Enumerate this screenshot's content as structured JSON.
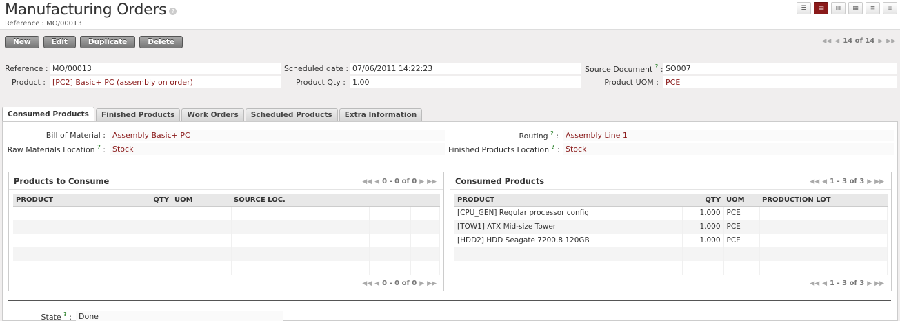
{
  "header": {
    "title": "Manufacturing Orders",
    "help": "?",
    "subtitle": "Reference : MO/00013"
  },
  "view_buttons": [
    "list-view-icon",
    "form-view-icon",
    "graph-view-icon",
    "calendar-view-icon",
    "gantt-view-icon",
    "diagram-view-icon"
  ],
  "toolbar": {
    "new_label": "New",
    "edit_label": "Edit",
    "duplicate_label": "Duplicate",
    "delete_label": "Delete",
    "pager": "14 of 14"
  },
  "form": {
    "reference_label": "Reference :",
    "reference_value": "MO/00013",
    "scheduled_label": "Scheduled date :",
    "scheduled_value": "07/06/2011 14:22:23",
    "source_label": "Source Document",
    "source_value": "SO007",
    "product_label": "Product :",
    "product_value": "[PC2] Basic+ PC (assembly on order)",
    "qty_label": "Product Qty :",
    "qty_value": "1.00",
    "uom_label": "Product UOM :",
    "uom_value": "PCE",
    "help_mark": "?"
  },
  "tabs": [
    {
      "label": "Consumed Products"
    },
    {
      "label": "Finished Products"
    },
    {
      "label": "Work Orders"
    },
    {
      "label": "Scheduled Products"
    },
    {
      "label": "Extra Information"
    }
  ],
  "tab_content": {
    "bom_label": "Bill of Material :",
    "bom_value": "Assembly Basic+ PC",
    "routing_label": "Routing",
    "routing_value": "Assembly Line 1",
    "raw_loc_label": "Raw Materials Location",
    "raw_loc_value": "Stock",
    "fin_loc_label": "Finished Products Location",
    "fin_loc_value": "Stock"
  },
  "to_consume": {
    "title": "Products to Consume",
    "pager": "0 - 0 of 0",
    "columns": [
      "PRODUCT",
      "QTY",
      "UOM",
      "SOURCE LOC."
    ]
  },
  "consumed": {
    "title": "Consumed Products",
    "pager": "1 - 3 of 3",
    "columns": [
      "PRODUCT",
      "QTY",
      "UOM",
      "PRODUCTION LOT"
    ],
    "rows": [
      {
        "product": "[CPU_GEN] Regular processor config",
        "qty": "1.000",
        "uom": "PCE",
        "lot": ""
      },
      {
        "product": "[TOW1] ATX Mid-size Tower",
        "qty": "1.000",
        "uom": "PCE",
        "lot": ""
      },
      {
        "product": "[HDD2] HDD Seagate 7200.8 120GB",
        "qty": "1.000",
        "uom": "PCE",
        "lot": ""
      }
    ]
  },
  "state": {
    "label": "State",
    "value": "Done"
  }
}
